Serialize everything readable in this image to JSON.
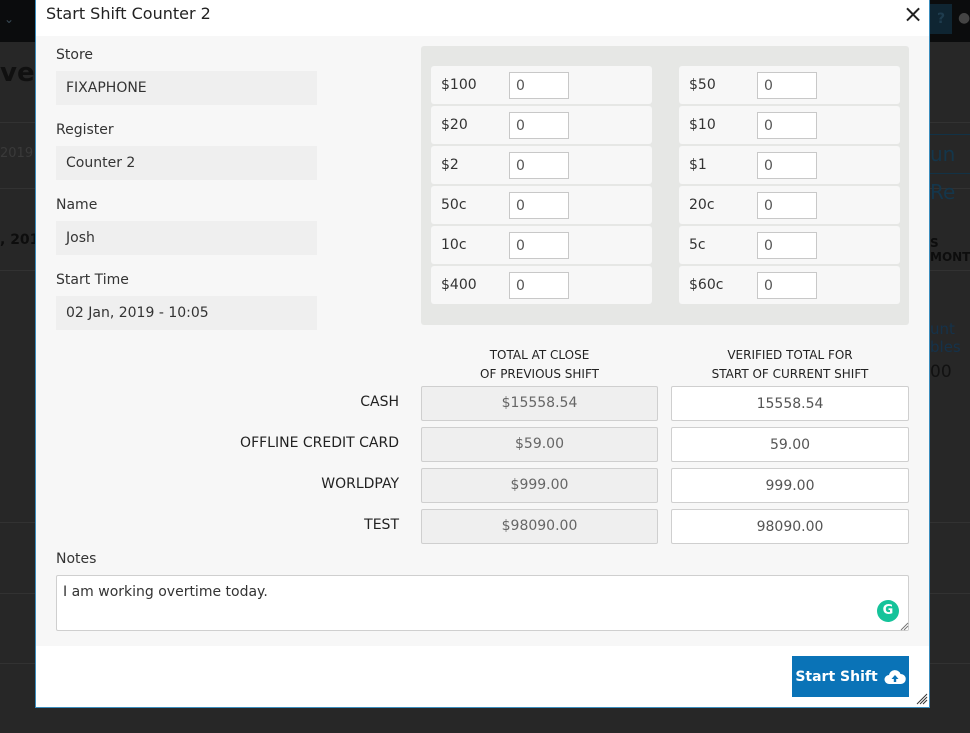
{
  "background": {
    "page_title_fragment": "ver",
    "date_fragment": "2019",
    "date_bold_fragment": ", 201",
    "run_fragment": "un Re",
    "month_fragment": "S MONT",
    "count_line1": "unt",
    "count_line2": "bles",
    "count_value": "00",
    "help_label": "?"
  },
  "modal": {
    "title": "Start Shift Counter 2",
    "close_icon": "×",
    "fields": {
      "store": {
        "label": "Store",
        "value": "FIXAPHONE"
      },
      "register": {
        "label": "Register",
        "value": "Counter 2"
      },
      "name": {
        "label": "Name",
        "value": "Josh"
      },
      "start_time": {
        "label": "Start Time",
        "value": "02 Jan, 2019 - 10:05"
      }
    },
    "denominations": [
      {
        "label": "$100",
        "value": "0"
      },
      {
        "label": "$50",
        "value": "0"
      },
      {
        "label": "$20",
        "value": "0"
      },
      {
        "label": "$10",
        "value": "0"
      },
      {
        "label": "$2",
        "value": "0"
      },
      {
        "label": "$1",
        "value": "0"
      },
      {
        "label": "50c",
        "value": "0"
      },
      {
        "label": "20c",
        "value": "0"
      },
      {
        "label": "10c",
        "value": "0"
      },
      {
        "label": "5c",
        "value": "0"
      },
      {
        "label": "$400",
        "value": "0"
      },
      {
        "label": "$60c",
        "value": "0"
      }
    ],
    "totals": {
      "prev_header_line1": "TOTAL AT CLOSE",
      "prev_header_line2": "OF PREVIOUS SHIFT",
      "cur_header_line1": "VERIFIED TOTAL FOR",
      "cur_header_line2": "START OF CURRENT SHIFT",
      "rows": [
        {
          "label": "CASH",
          "previous": "$15558.54",
          "current": "15558.54"
        },
        {
          "label": "OFFLINE CREDIT CARD",
          "previous": "$59.00",
          "current": "59.00"
        },
        {
          "label": "WORLDPAY",
          "previous": "$999.00",
          "current": "999.00"
        },
        {
          "label": "TEST",
          "previous": "$98090.00",
          "current": "98090.00"
        }
      ]
    },
    "notes": {
      "label": "Notes",
      "value": "I am working overtime today."
    },
    "start_button_label": "Start Shift",
    "accent_color": "#0a73b7"
  }
}
